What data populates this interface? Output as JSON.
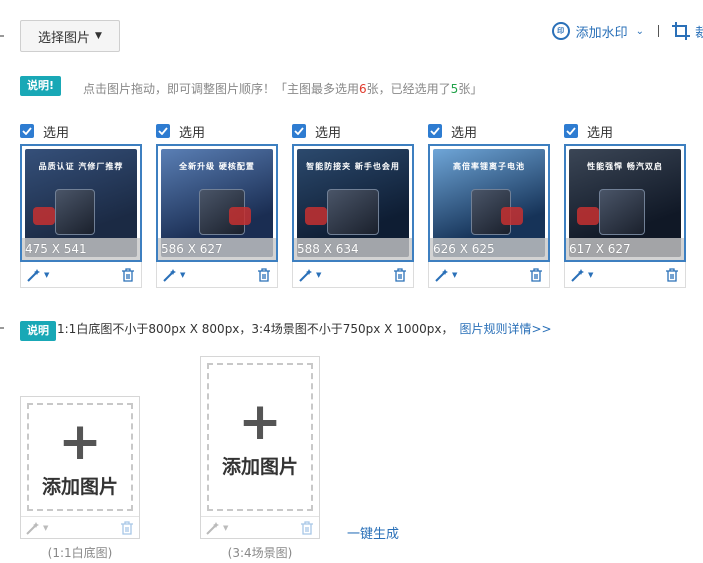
{
  "toolbar": {
    "select_label": "选择图片",
    "watermark_label": "添加水印",
    "crop_label": "裁"
  },
  "notice": {
    "badge": "说明!",
    "text_before": "点击图片拖动，即可调整图片顺序！「主图最多选用",
    "max_count": "6",
    "text_mid": "张，已经选用了",
    "used_count": "5",
    "text_after": "张」"
  },
  "thumbnails": [
    {
      "check_label": "选用",
      "checked": true,
      "dimensions": "475 X 541",
      "poster_title": "品质认证 汽修厂推荐",
      "palette": [
        "#1b2a44",
        "#35507a"
      ]
    },
    {
      "check_label": "选用",
      "checked": true,
      "dimensions": "586 X 627",
      "poster_title": "全新升级 硬核配置",
      "palette": [
        "#1a2d52",
        "#5a7fb5"
      ]
    },
    {
      "check_label": "选用",
      "checked": true,
      "dimensions": "588 X 634",
      "poster_title": "智能防接夹 新手也会用",
      "palette": [
        "#0e1d33",
        "#2c4a6e"
      ]
    },
    {
      "check_label": "选用",
      "checked": true,
      "dimensions": "626 X 625",
      "poster_title": "高倍率锂离子电池",
      "palette": [
        "#163358",
        "#6fa6d8"
      ]
    },
    {
      "check_label": "选用",
      "checked": true,
      "dimensions": "617 X 627",
      "poster_title": "性能强悍 畅汽双启",
      "palette": [
        "#101826",
        "#3b4656"
      ]
    }
  ],
  "rules": {
    "badge": "说明",
    "text": "1:1白底图不小于800px X 800px，3:4场景图不小于750px X 1000px，",
    "link": "图片规则详情>>"
  },
  "add_slots": [
    {
      "plus": "+",
      "label": "添加图片",
      "caption": "(1:1白底图)"
    },
    {
      "plus": "+",
      "label": "添加图片",
      "caption": "(3:4场景图)"
    }
  ],
  "generate_label": "一键生成",
  "colors": {
    "accent": "#2a70b8",
    "badge": "#19a8b6",
    "checkbox": "#2e7cd1",
    "count_red": "#e0392b",
    "count_green": "#22a24a"
  },
  "icons": {
    "select": "chevron-down-icon",
    "watermark": "watermark-icon",
    "crop": "crop-icon",
    "magic": "magic-wand-icon",
    "delete": "trash-icon",
    "check": "check-icon"
  }
}
